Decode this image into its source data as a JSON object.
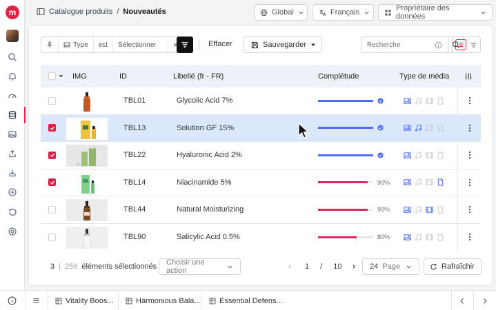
{
  "app": {
    "logo_letter": "m"
  },
  "sidebar": {
    "items": [
      {
        "icon": "search-icon"
      },
      {
        "icon": "bell-icon"
      },
      {
        "icon": "dashboard-gauge-icon"
      },
      {
        "icon": "database-icon"
      },
      {
        "icon": "image-icon"
      },
      {
        "icon": "upload-icon"
      },
      {
        "icon": "download-icon"
      },
      {
        "icon": "add-circle-icon"
      },
      {
        "icon": "history-icon"
      },
      {
        "icon": "settings-icon"
      }
    ],
    "active_icon": "database-icon"
  },
  "breadcrumb": {
    "parent": "Catalogue produits",
    "separator": "/",
    "current": "Nouveautés"
  },
  "topbar": {
    "scope": "Global",
    "language": "Français",
    "owner": "Propriétaire des données"
  },
  "toolbar": {
    "filter": {
      "field": "Type",
      "operator": "est",
      "value": "Sélectionner",
      "clear": "×"
    },
    "clear_label": "Effacer",
    "save_label": "Sauvegarder",
    "search_placeholder": "Recherche"
  },
  "table": {
    "headers": {
      "img": "IMG",
      "id": "ID",
      "label": "Libellé (fr - FR)",
      "completeness": "Complétude",
      "media": "Type de média"
    },
    "rows": [
      {
        "id": "TBL01",
        "label": "Glycolic Acid 7%",
        "checked": false,
        "highlight": false,
        "completeness": 100,
        "complete": true,
        "pct_label": "",
        "media_active": [
          "image"
        ],
        "product": "amber-dropper"
      },
      {
        "id": "TBL13",
        "label": "Solution GF 15%",
        "checked": true,
        "highlight": true,
        "completeness": 100,
        "complete": true,
        "pct_label": "",
        "media_active": [
          "image",
          "audio"
        ],
        "product": "yellow-box"
      },
      {
        "id": "TBL22",
        "label": "Hyaluronic Acid 2%",
        "checked": true,
        "highlight": false,
        "completeness": 100,
        "complete": true,
        "pct_label": "",
        "media_active": [
          "image"
        ],
        "product": "green-bottle"
      },
      {
        "id": "TBL14",
        "label": "Niacinamide 5%",
        "checked": true,
        "highlight": false,
        "completeness": 90,
        "complete": false,
        "pct_label": "90%",
        "media_active": [
          "image",
          "document"
        ],
        "product": "green-box"
      },
      {
        "id": "TBL44",
        "label": "Natural Moisturizing",
        "checked": false,
        "highlight": false,
        "completeness": 90,
        "complete": false,
        "pct_label": "90%",
        "media_active": [
          "image",
          "video"
        ],
        "product": "brown-dropper"
      },
      {
        "id": "TBL90",
        "label": "Salicylic Acid 0.5%",
        "checked": false,
        "highlight": false,
        "completeness": 80,
        "complete": false,
        "pct_label": "80%",
        "media_active": [
          "image"
        ],
        "product": "white-dropper"
      }
    ]
  },
  "footer": {
    "selected": "3",
    "total": "256",
    "selected_label": "éléments sélectionnés",
    "action_placeholder": "Choisir une action",
    "page_current": "1",
    "page_sep": "/",
    "page_total": "10",
    "per_page": "24",
    "per_page_label": "Page",
    "refresh_label": "Rafraîchir"
  },
  "bottombar": {
    "tabs": [
      "Vitality Boos...",
      "Harmonious Bala...",
      "Essential Defens..."
    ]
  },
  "colors": {
    "accent": "#e52345",
    "blue": "#4a6cf7",
    "progress_incomplete": "#d9285a",
    "highlight_row": "#dbe8fb"
  }
}
